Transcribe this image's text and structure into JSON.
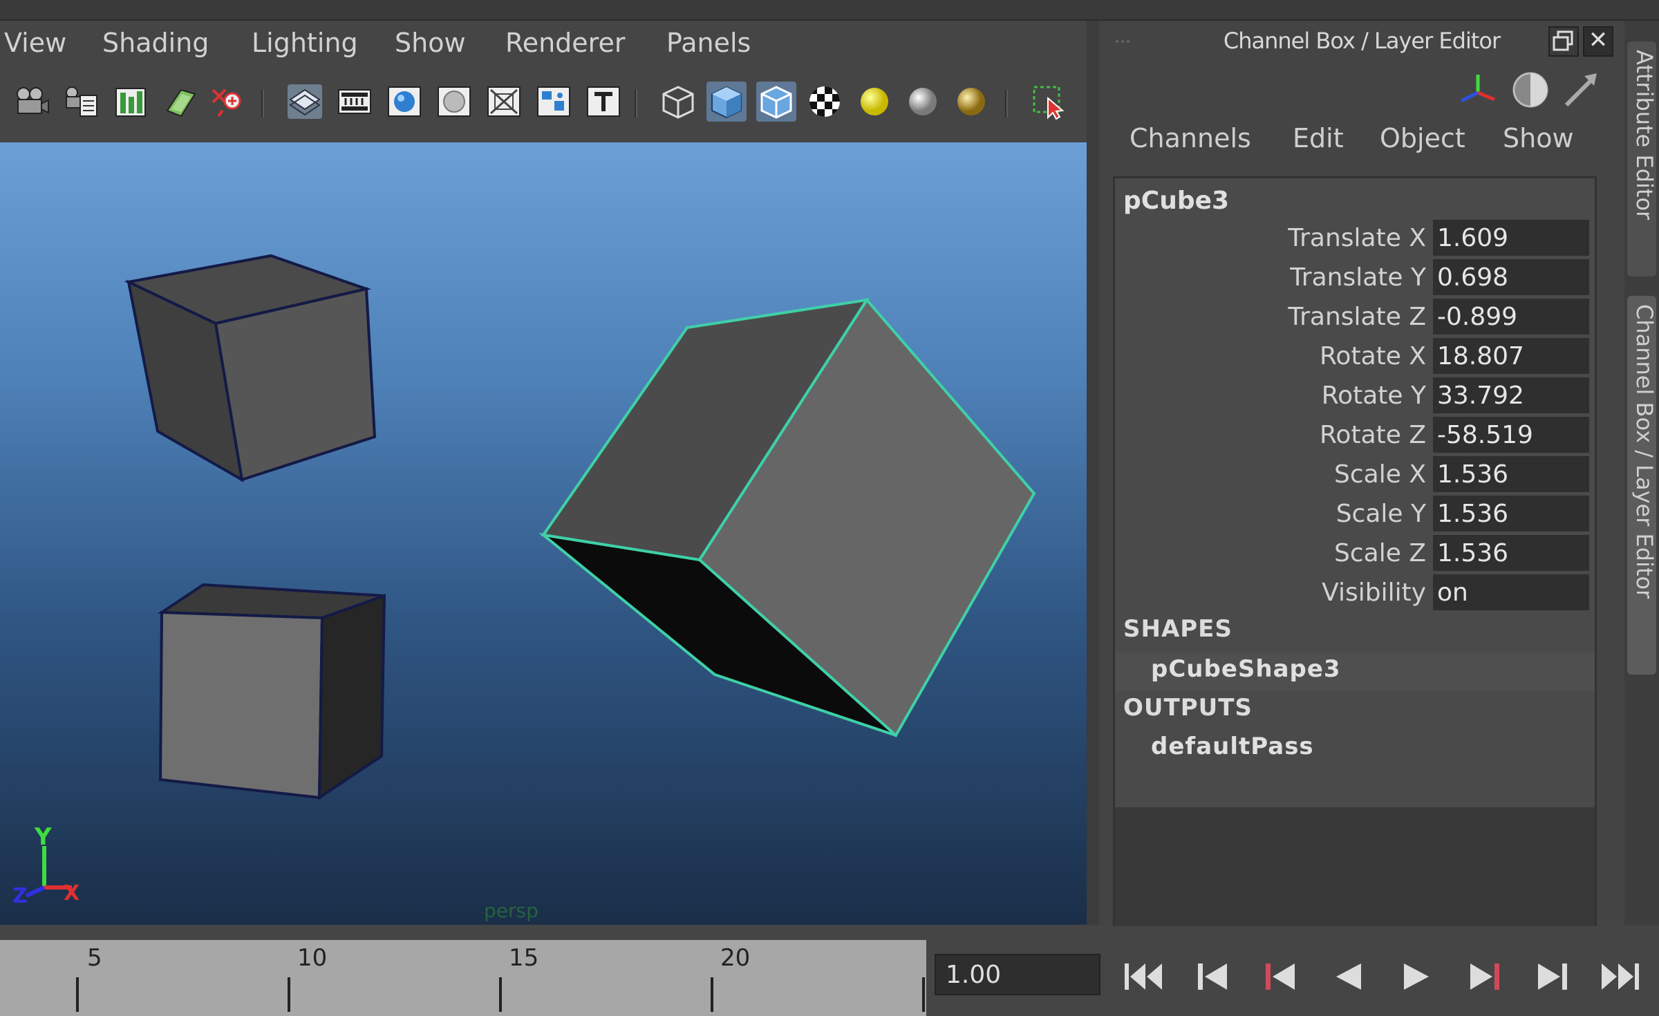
{
  "panel_menu": [
    "View",
    "Shading",
    "Lighting",
    "Show",
    "Renderer",
    "Panels"
  ],
  "toolbar_icons": [
    "camera-select-icon",
    "camera-attributes-icon",
    "bookmarks-icon",
    "image-plane-icon",
    "two-d-pan-zoom-icon",
    "grid-icon",
    "film-gate-icon",
    "resolution-gate-icon",
    "gate-mask-icon",
    "field-chart-icon",
    "safe-action-icon",
    "safe-title-icon",
    "wireframe-icon",
    "smooth-shade-all-icon",
    "wireframe-on-shaded-icon",
    "textured-icon",
    "use-all-lights-icon",
    "shadows-icon",
    "screen-space-ambient-occlusion-icon",
    "isolate-select-icon"
  ],
  "channel_box": {
    "title": "Channel Box / Layer Editor",
    "menus": [
      "Channels",
      "Edit",
      "Object",
      "Show"
    ],
    "object_name": "pCube3",
    "attributes": [
      {
        "label": "Translate X",
        "value": "1.609"
      },
      {
        "label": "Translate Y",
        "value": "0.698"
      },
      {
        "label": "Translate Z",
        "value": "-0.899"
      },
      {
        "label": "Rotate X",
        "value": "18.807"
      },
      {
        "label": "Rotate Y",
        "value": "33.792"
      },
      {
        "label": "Rotate Z",
        "value": "-58.519"
      },
      {
        "label": "Scale X",
        "value": "1.536"
      },
      {
        "label": "Scale Y",
        "value": "1.536"
      },
      {
        "label": "Scale Z",
        "value": "1.536"
      },
      {
        "label": "Visibility",
        "value": "on"
      }
    ],
    "shapes_header": "SHAPES",
    "shape_node": "pCubeShape3",
    "outputs_header": "OUTPUTS",
    "output_node": "defaultPass",
    "close_glyph": "✕"
  },
  "side_tabs": [
    "Attribute Editor",
    "Channel Box / Layer Editor"
  ],
  "viewport": {
    "axis_y_label": "Y",
    "axis_x_label": "X",
    "axis_z_label": "Z",
    "camera_label": "persp",
    "selection_color": "#3fd0a8"
  },
  "timeline": {
    "tick_labels": [
      "5",
      "10",
      "15",
      "20"
    ],
    "current_frame": "1.00"
  },
  "playback_controls": [
    "go-to-start-icon",
    "step-back-key-icon",
    "step-back-frame-icon",
    "play-backwards-icon",
    "play-forwards-icon",
    "step-forward-frame-icon",
    "step-forward-key-icon",
    "go-to-end-icon"
  ]
}
